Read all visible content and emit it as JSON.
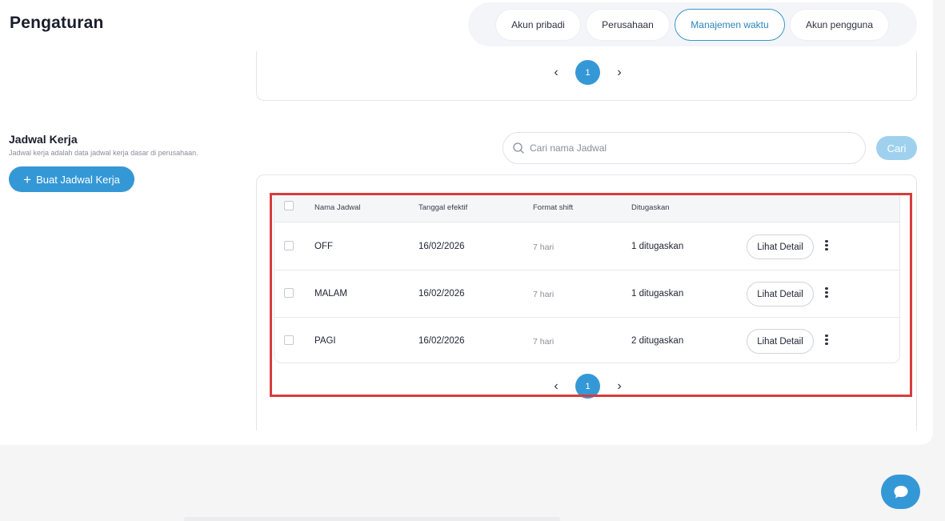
{
  "header": {
    "title": "Pengaturan",
    "tabs": [
      {
        "label": "Akun pribadi"
      },
      {
        "label": "Perusahaan"
      },
      {
        "label": "Manajemen waktu"
      },
      {
        "label": "Akun pengguna"
      }
    ],
    "active_tab": "Manajemen waktu"
  },
  "top_pagination": {
    "prev": "‹",
    "page": "1",
    "next": "›"
  },
  "schedule_section": {
    "title": "Jadwal Kerja",
    "subtitle": "Jadwal kerja adalah data jadwal kerja dasar di perusahaan.",
    "create_button": {
      "icon": "plus-icon",
      "label": "Buat Jadwal Kerja"
    }
  },
  "search": {
    "placeholder": "Cari nama Jadwal",
    "value": "",
    "button_label": "Cari",
    "icon": "search-icon"
  },
  "table": {
    "columns": [
      "Nama Jadwal",
      "Tanggal efektif",
      "Format shift",
      "Ditugaskan"
    ],
    "rows": [
      {
        "name": "OFF",
        "date": "16/02/2026",
        "shift": "7 hari",
        "assigned": "1 ditugaskan",
        "action": "Lihat Detail"
      },
      {
        "name": "MALAM",
        "date": "16/02/2026",
        "shift": "7 hari",
        "assigned": "1 ditugaskan",
        "action": "Lihat Detail"
      },
      {
        "name": "PAGI",
        "date": "16/02/2026",
        "shift": "7 hari",
        "assigned": "2 ditugaskan",
        "action": "Lihat Detail"
      }
    ]
  },
  "table_pagination": {
    "prev": "‹",
    "page": "1",
    "next": "›"
  },
  "colors": {
    "accent": "#3598d6",
    "highlight": "#d83c3c",
    "disabled_button": "#9fd1ee"
  },
  "chat_button": {
    "icon": "chat-icon"
  }
}
